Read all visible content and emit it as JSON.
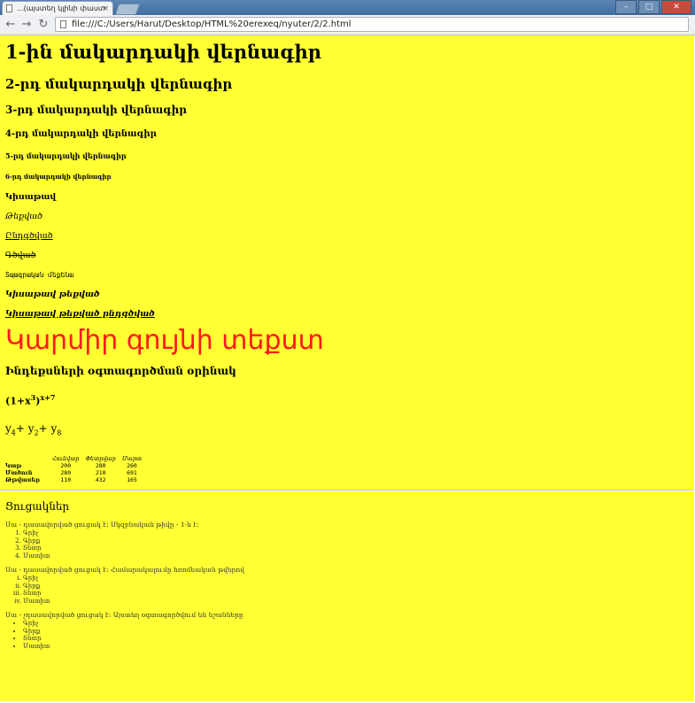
{
  "browser": {
    "tab_title": "...(այստեղ կլինի փաստ",
    "url": "file:///C:/Users/Harut/Desktop/HTML%20erexeq/nyuter/2/2.html",
    "back_icon": "back-arrow-icon",
    "forward_icon": "forward-arrow-icon",
    "reload_icon": "reload-icon"
  },
  "page": {
    "background": "#ffff33",
    "headings": {
      "h1": "1-ին մակարդակի վերնագիր",
      "h2": "2-րդ մակարդակի վերնագիր",
      "h3": "3-րդ մակարդակի վերնագիր",
      "h4": "4-րդ մակարդակի վերնագիր",
      "h5": "5-րդ մակարդակի վերնագիր",
      "h6": "6-րդ մակարդակի վերնագիր"
    },
    "styles": {
      "bold": "Կիսաթավ",
      "italic": "Թեքված",
      "underline": "Ընդգծված",
      "strike": "Գծված",
      "mono": "Տպագրական  մեքենա",
      "bold_italic": "Կիսաթավ թեքված",
      "bold_italic_underline": "Կիսաթավ թեքված ընդգծված"
    },
    "red_text": "Կարմիր գույնի տեքստ",
    "red_color": "#ff1a1a",
    "index_title": "Ինդեքսների օգտագործման օրինակ",
    "formula": {
      "base_open": "(1+x",
      "exp1": "3",
      "close": ")",
      "exp2": "x+7"
    },
    "subscripts": {
      "a": "y",
      "a_sub": "4",
      "plus1": "+ ",
      "b": "y",
      "b_sub": "2",
      "plus2": "+ ",
      "c": "y",
      "c_sub": "8"
    },
    "table": {
      "columns": [
        "",
        "Հունվար",
        "Փետրվար",
        "Մարտ"
      ],
      "rows": [
        [
          "Կաթ",
          "200",
          "280",
          "260"
        ],
        [
          "Մածուն",
          "280",
          "210",
          "691"
        ],
        [
          "Թթվասեր",
          "110",
          "432",
          "165"
        ]
      ]
    },
    "lists": {
      "title": "Ցուցակներ",
      "ordered_intro": "Սա - դասավորված ցուցակ է: Սկզբնական թիվը - 1-ն է:",
      "ordered_items": [
        "Գրիչ",
        "Գիրք",
        "Տետր",
        "Մատիտ"
      ],
      "roman_intro": "Սա - դասավորված ցուցակ է: Համարակալումը հռոմեական թվերով",
      "roman_items": [
        "Գրիչ",
        "Գիրք",
        "Տետր",
        "Մատիտ"
      ],
      "unordered_intro": "Սա - չդասավորված ցուցակ է: Այստեղ օգտագործվում են նշանները",
      "unordered_items": [
        "Գրիչ",
        "Գիրք",
        "Տետր",
        "Մատիտ"
      ]
    }
  }
}
